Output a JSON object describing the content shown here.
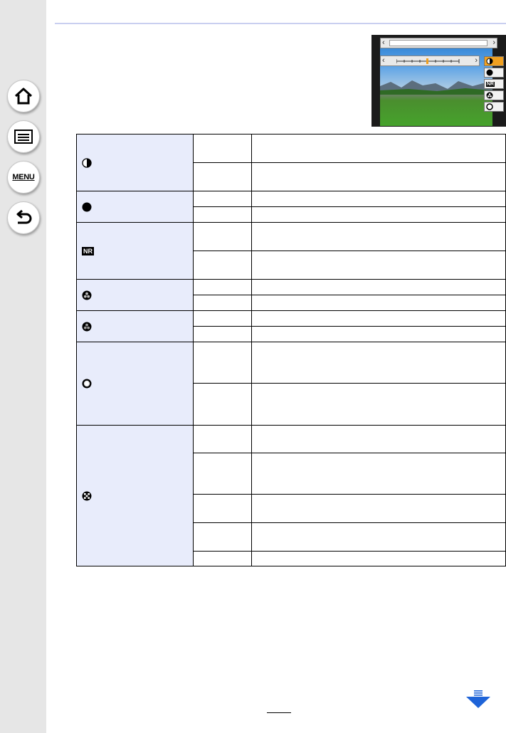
{
  "sidebar": {
    "home": "home-icon",
    "contents": "list-icon",
    "menu_label": "MENU",
    "back": "back-icon"
  },
  "preview": {
    "description": "camera photo style adjustment screen",
    "icons": [
      "contrast-icon",
      "sharpness-icon",
      "noise-reduction-icon",
      "saturation-icon",
      "color-tone-icon"
    ]
  },
  "table": {
    "rows": [
      {
        "icon": "contrast-icon",
        "sub_rows": 2
      },
      {
        "icon": "sharpness-icon",
        "sub_rows": 2
      },
      {
        "icon": "noise-reduction-icon",
        "icon_text": "NR",
        "sub_rows": 2
      },
      {
        "icon": "saturation-icon",
        "sub_rows": 2
      },
      {
        "icon": "color-tone-icon",
        "sub_rows": 2
      },
      {
        "icon": "hue-icon",
        "sub_rows": 2
      },
      {
        "icon": "filter-effect-icon",
        "sub_rows": 5
      }
    ]
  },
  "footer": {
    "next_page": "down-arrow-icon"
  },
  "colors": {
    "sidebar_bg": "#e6e6e6",
    "table_icon_bg": "#e8ecfb",
    "top_rule": "#c9cff0",
    "arrow": "#1e63d8",
    "active_tab": "#f0a020"
  }
}
